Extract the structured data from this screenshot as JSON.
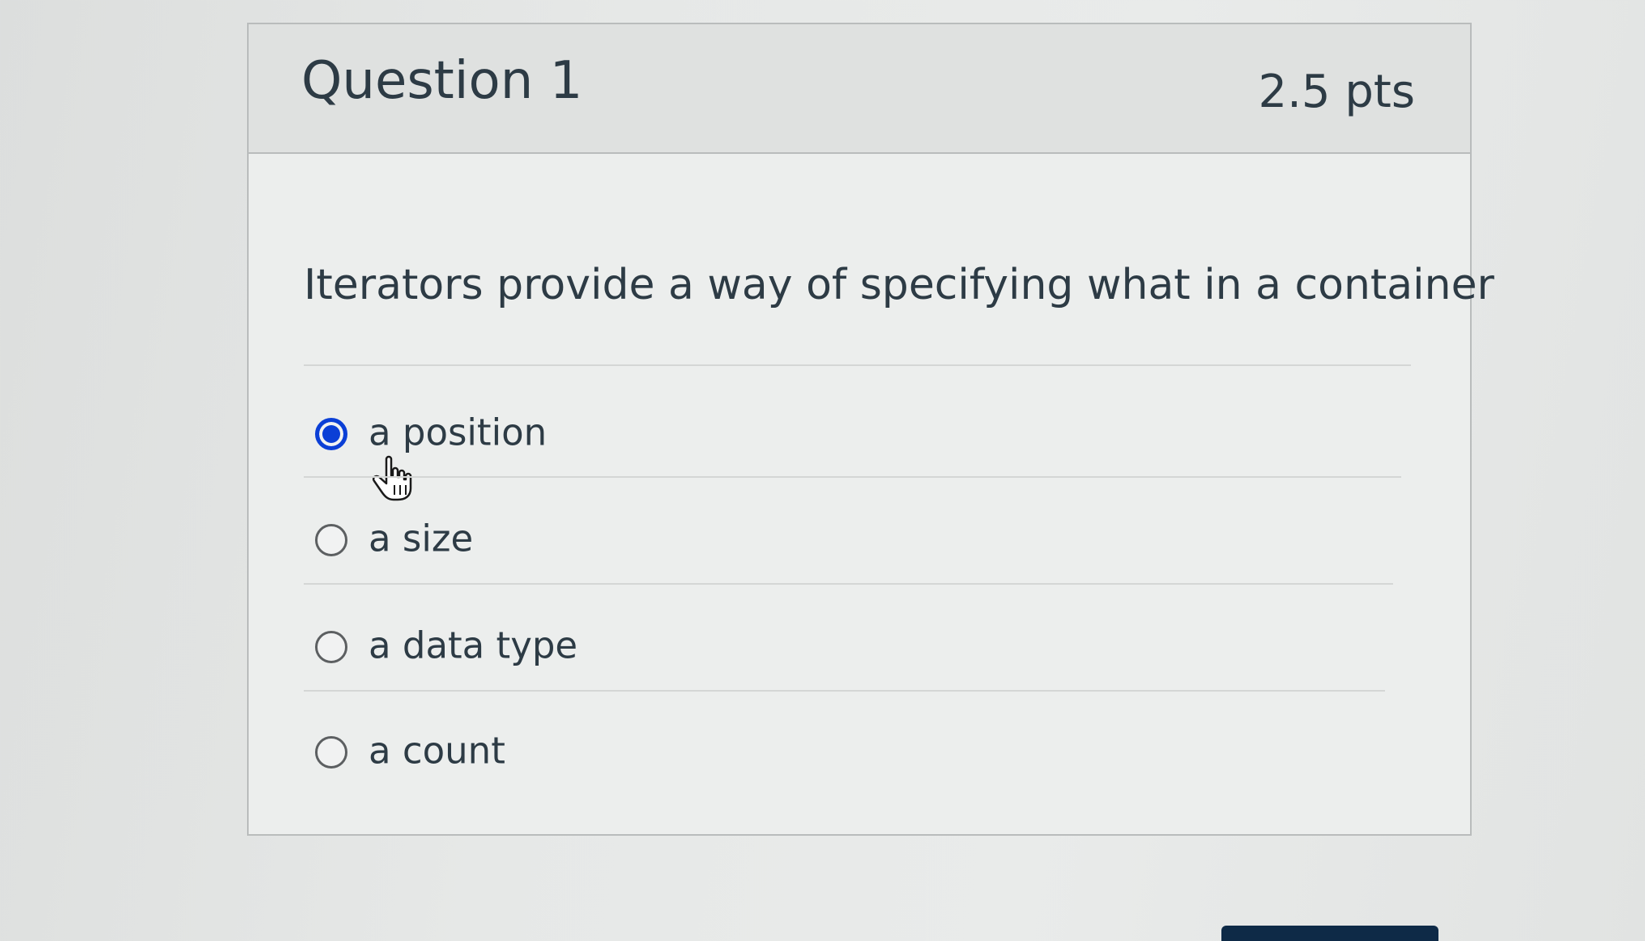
{
  "question": {
    "title": "Question 1",
    "points": "2.5 pts",
    "text": "Iterators provide a way of specifying what in a container"
  },
  "answers": [
    {
      "label": "a position",
      "selected": true
    },
    {
      "label": "a size",
      "selected": false
    },
    {
      "label": "a data type",
      "selected": false
    },
    {
      "label": "a count",
      "selected": false
    }
  ],
  "colors": {
    "selected_radio": "#0b3fd6",
    "text": "#2d3b45",
    "header_bg": "#dfe1e0",
    "button_bg": "#0e2a47"
  },
  "icons": {
    "cursor": "hand-pointer-icon"
  }
}
